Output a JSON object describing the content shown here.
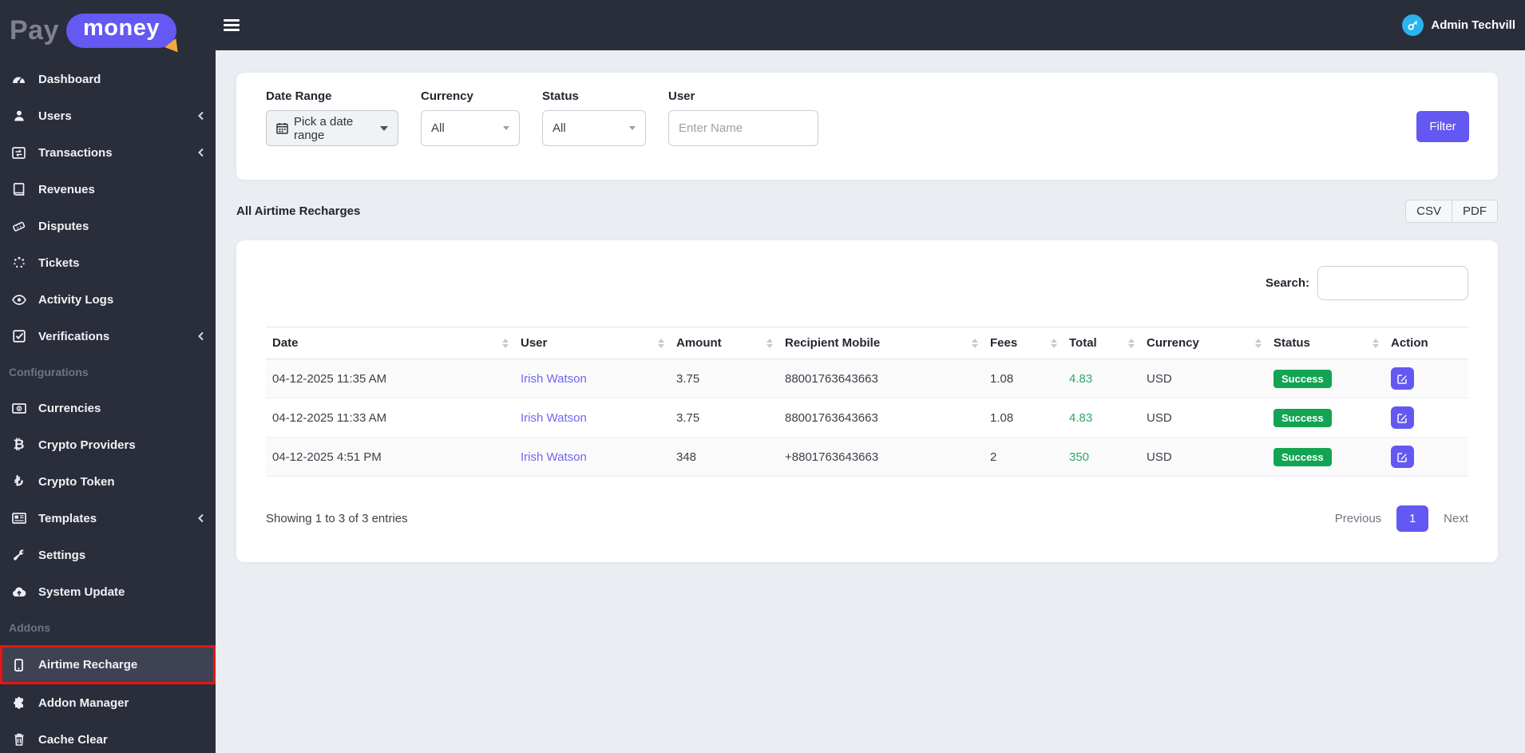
{
  "brand": {
    "name_part1": "Pay",
    "name_part2": "money"
  },
  "topbar": {
    "user_name": "Admin Techvill"
  },
  "sidebar": {
    "sections": {
      "configurations": "Configurations",
      "addons": "Addons"
    },
    "items": {
      "dashboard": "Dashboard",
      "users": "Users",
      "transactions": "Transactions",
      "revenues": "Revenues",
      "disputes": "Disputes",
      "tickets": "Tickets",
      "activity_logs": "Activity Logs",
      "verifications": "Verifications",
      "currencies": "Currencies",
      "crypto_providers": "Crypto Providers",
      "crypto_token": "Crypto Token",
      "templates": "Templates",
      "settings": "Settings",
      "system_update": "System Update",
      "airtime_recharge": "Airtime Recharge",
      "addon_manager": "Addon Manager",
      "cache_clear": "Cache Clear",
      "crypto_providers_glyph": "₿",
      "crypto_token_glyph": "₺"
    }
  },
  "filters": {
    "date_range_label": "Date Range",
    "date_range_value": "Pick a date range",
    "currency_label": "Currency",
    "currency_value": "All",
    "status_label": "Status",
    "status_value": "All",
    "user_label": "User",
    "user_placeholder": "Enter Name",
    "filter_button": "Filter"
  },
  "page": {
    "heading": "All Airtime Recharges",
    "export_csv": "CSV",
    "export_pdf": "PDF"
  },
  "table": {
    "search_label": "Search:",
    "columns": [
      "Date",
      "User",
      "Amount",
      "Recipient Mobile",
      "Fees",
      "Total",
      "Currency",
      "Status",
      "Action"
    ],
    "rows": [
      {
        "date": "04-12-2025 11:35 AM",
        "user": "Irish Watson",
        "amount": "3.75",
        "recipient_mobile": "88001763643663",
        "fees": "1.08",
        "total": "4.83",
        "currency": "USD",
        "status": "Success"
      },
      {
        "date": "04-12-2025 11:33 AM",
        "user": "Irish Watson",
        "amount": "3.75",
        "recipient_mobile": "88001763643663",
        "fees": "1.08",
        "total": "4.83",
        "currency": "USD",
        "status": "Success"
      },
      {
        "date": "04-12-2025 4:51 PM",
        "user": "Irish Watson",
        "amount": "348",
        "recipient_mobile": "+8801763643663",
        "fees": "2",
        "total": "350",
        "currency": "USD",
        "status": "Success"
      }
    ],
    "showing_text": "Showing 1 to 3 of 3 entries",
    "pagination": {
      "previous": "Previous",
      "current_page": "1",
      "next": "Next"
    }
  },
  "colors": {
    "accent_purple": "#6358f1",
    "success_green": "#13a452",
    "total_green": "#2aa76c",
    "link_purple": "#7166f2",
    "highlight_red": "#e81515",
    "avatar_blue": "#29b3ef",
    "sidebar_dark": "#2a2d3a"
  }
}
